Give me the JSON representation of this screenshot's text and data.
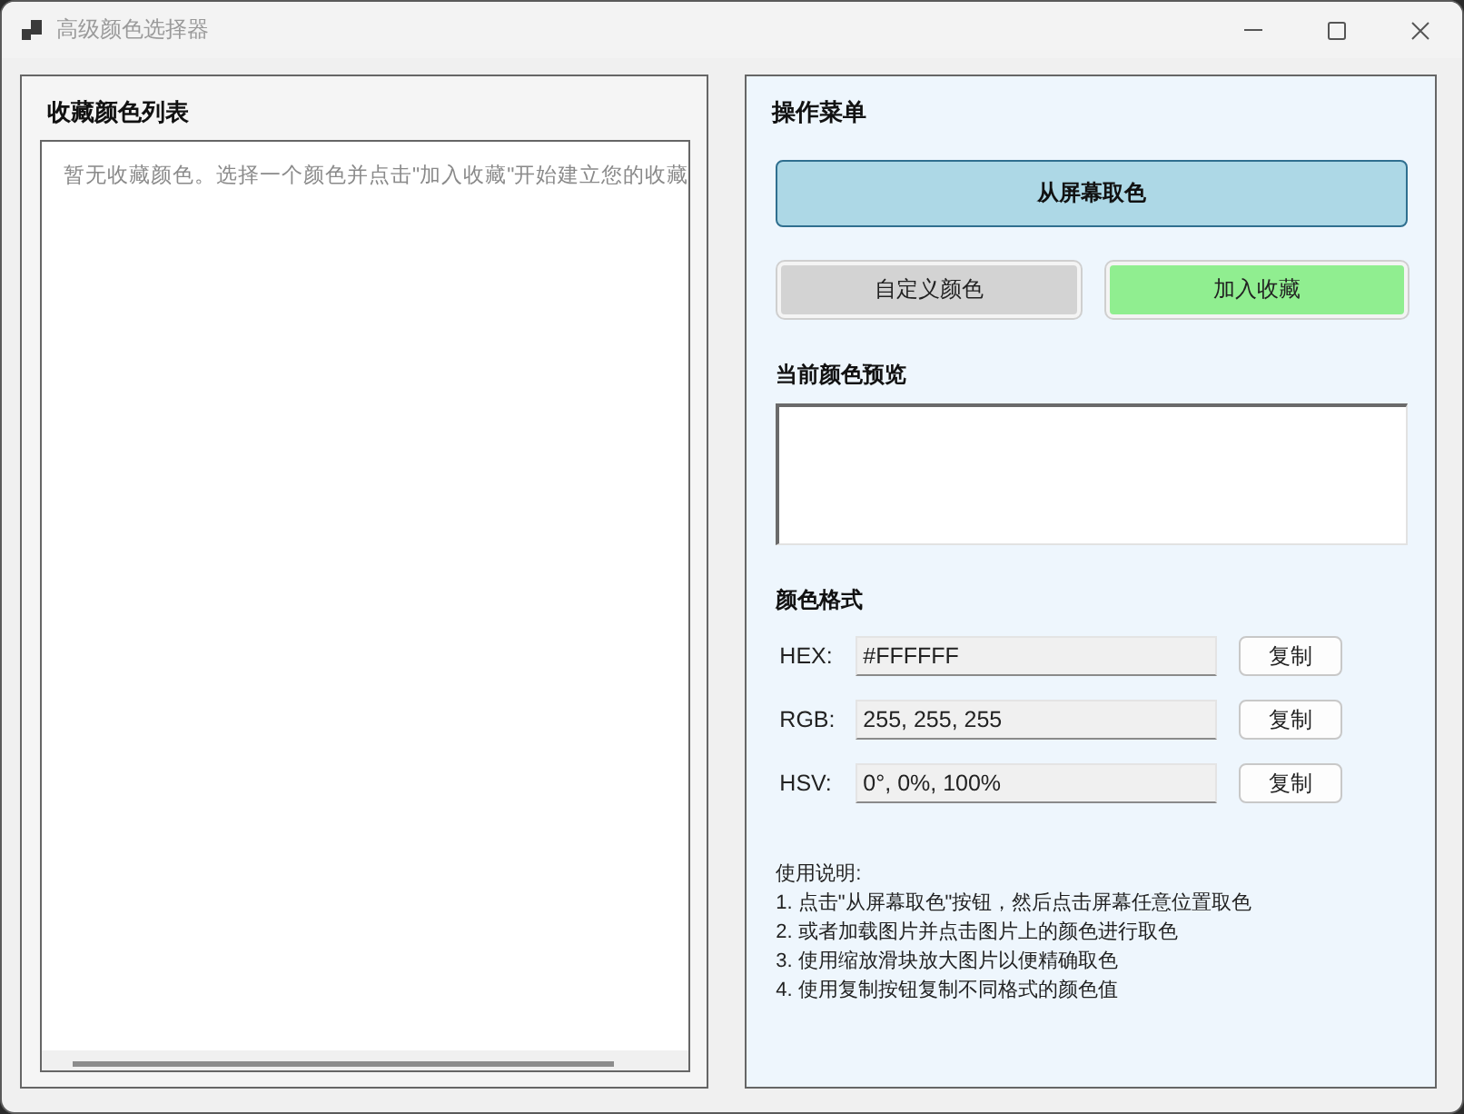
{
  "window": {
    "title": "高级颜色选择器"
  },
  "favorites_panel": {
    "title": "收藏颜色列表",
    "list": {
      "placeholder": "暂无收藏颜色。选择一个颜色并点击\"加入收藏\"开始建立您的收藏"
    }
  },
  "menu_panel": {
    "title": "操作菜单",
    "actions": [
      {
        "label": "从屏幕取色",
        "kind": "wide",
        "color": "#add8e6"
      },
      {
        "label": "自定义颜色",
        "kind": "half",
        "color": "#d3d3d3"
      },
      {
        "label": "加入收藏",
        "kind": "half",
        "color": "#90ee90"
      }
    ],
    "preview": {
      "title": "当前颜色预览",
      "color": "#ffffff"
    },
    "formats": {
      "title": "颜色格式",
      "rows": [
        {
          "label": "HEX:",
          "value": "#FFFFFF",
          "button": "复制"
        },
        {
          "label": "RGB:",
          "value": "255, 255, 255",
          "button": "复制"
        },
        {
          "label": "HSV:",
          "value": "0°, 0%, 100%",
          "button": "复制"
        }
      ]
    },
    "instructions": {
      "title": "使用说明:",
      "lines": [
        "1. 点击\"从屏幕取色\"按钮，然后点击屏幕任意位置取色",
        "2. 或者加载图片并点击图片上的颜色进行取色",
        "3. 使用缩放滑块放大图片以便精确取色",
        "4. 使用复制按钮复制不同格式的颜色值"
      ]
    }
  }
}
